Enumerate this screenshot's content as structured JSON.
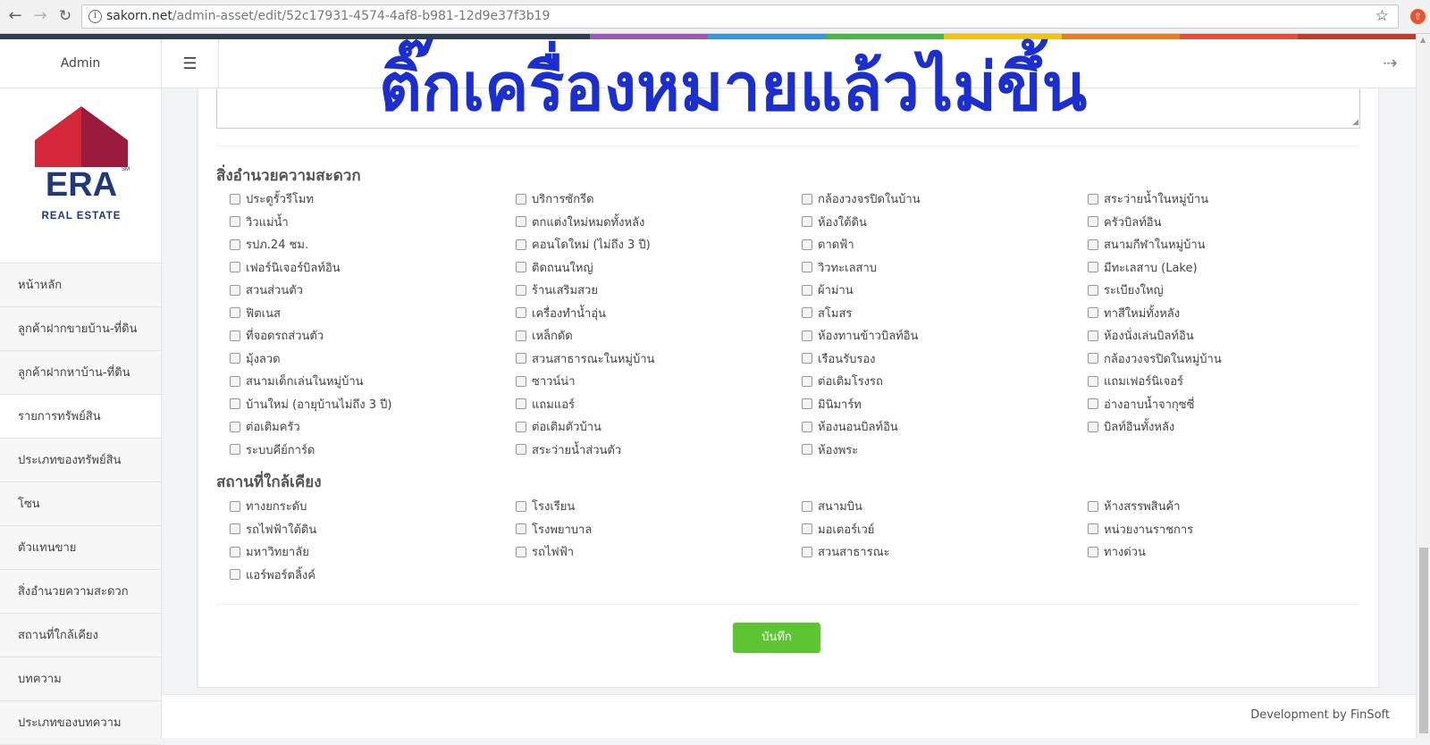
{
  "browser": {
    "url_host": "sakorn.net",
    "url_path": "/admin-asset/edit/52c17931-4574-4af8-b981-12d9e37f3b19"
  },
  "colors": {
    "rainbow": [
      "#2c3e50",
      "#2c3e50",
      "#2c3e50",
      "#2c3e50",
      "#2c3e50",
      "#9b59b6",
      "#3498db",
      "#4bb543",
      "#f1c40f",
      "#e67e22",
      "#e74c3c",
      "#c0392b"
    ],
    "save_button": "#5dc432",
    "overlay_text": "#1b2fd0"
  },
  "sidebar": {
    "header": "Admin",
    "logo": {
      "main": "ERA",
      "sub": "REAL ESTATE",
      "mark": "SM"
    },
    "items": [
      {
        "label": "หน้าหลัก"
      },
      {
        "label": "ลูกค้าฝากขายบ้าน-ที่ดิน"
      },
      {
        "label": "ลูกค้าฝากหาบ้าน-ที่ดิน"
      },
      {
        "label": "รายการทรัพย์สิน"
      },
      {
        "label": "ประเภทของทรัพย์สิน"
      },
      {
        "label": "โซน"
      },
      {
        "label": "ตัวแทนขาย"
      },
      {
        "label": "สิ่งอำนวยความสะดวก"
      },
      {
        "label": "สถานที่ใกล้เคียง"
      },
      {
        "label": "บทความ"
      },
      {
        "label": "ประเภทของบทความ"
      }
    ]
  },
  "overlay": {
    "text": "ติ๊กเครื่องหมายแล้วไม่ขึ้น"
  },
  "facilities": {
    "title": "สิ่งอำนวยความสะดวก",
    "items": [
      "ประตูรั้วรีโมท",
      "บริการซักรีด",
      "กล้องวงจรปิดในบ้าน",
      "สระว่ายน้ำในหมู่บ้าน",
      "วิวแม่น้ำ",
      "ตกแต่งใหม่หมดทั้งหลัง",
      "ห้องใต้ดิน",
      "ครัวบิลท์อิน",
      "รปภ.24 ชม.",
      "คอนโดใหม่ (ไม่ถึง 3 ปี)",
      "ดาดฟ้า",
      "สนามกีฬาในหมู่บ้าน",
      "เฟอร์นิเจอร์บิลท์อิน",
      "ติดถนนใหญ่",
      "วิวทะเลสาบ",
      "มีทะเลสาบ (Lake)",
      "สวนส่วนตัว",
      "ร้านเสริมสวย",
      "ผ้าม่าน",
      "ระเบียงใหญ่",
      "ฟิตเนส",
      "เครื่องทำน้ำอุ่น",
      "สโมสร",
      "ทาสีใหม่ทั้งหลัง",
      "ที่จอดรถส่วนตัว",
      "เหล็กดัด",
      "ห้องทานข้าวบิลท์อิน",
      "ห้องนั่งเล่นบิลท์อิน",
      "มุ้งลวด",
      "สวนสาธารณะในหมู่บ้าน",
      "เรือนรับรอง",
      "กล้องวงจรปิดในหมู่บ้าน",
      "สนามเด็กเล่นในหมู่บ้าน",
      "ซาวน์น่า",
      "ต่อเติมโรงรถ",
      "แถมเฟอร์นิเจอร์",
      "บ้านใหม่ (อายุบ้านไม่ถึง 3 ปี)",
      "แถมแอร์",
      "มินิมาร์ท",
      "อ่างอาบน้ำจากุซซี่",
      "ต่อเติมครัว",
      "ต่อเติมตัวบ้าน",
      "ห้องนอนบิลท์อิน",
      "บิลท์อินทั้งหลัง",
      "ระบบคีย์การ์ด",
      "สระว่ายน้ำส่วนตัว",
      "ห้องพระ"
    ]
  },
  "nearby": {
    "title": "สถานที่ใกล้เคียง",
    "items": [
      "ทางยกระดับ",
      "โรงเรียน",
      "สนามบิน",
      "ห้างสรรพสินค้า",
      "รถไฟฟ้าใต้ดิน",
      "โรงพยาบาล",
      "มอเตอร์เวย์",
      "หน่วยงานราชการ",
      "มหาวิทยาลัย",
      "รถไฟฟ้า",
      "สวนสาธารณะ",
      "ทางด่วน",
      "แอร์พอร์ตลิ้งค์"
    ]
  },
  "actions": {
    "save_label": "บันทึก"
  },
  "footer": {
    "text": "Development by FinSoft"
  }
}
